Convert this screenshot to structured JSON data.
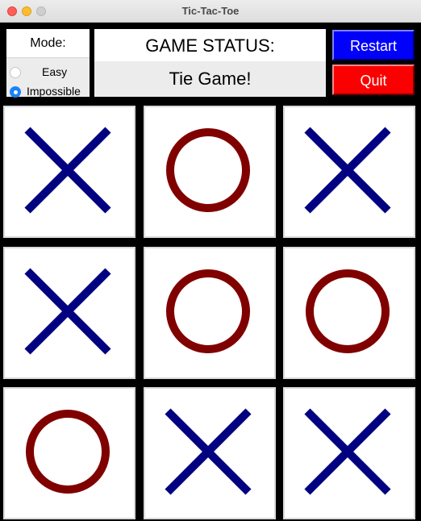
{
  "window": {
    "title": "Tic-Tac-Toe"
  },
  "mode": {
    "label": "Mode:",
    "options": [
      {
        "label": "Easy",
        "selected": false
      },
      {
        "label": "Impossible",
        "selected": true
      }
    ]
  },
  "status": {
    "heading": "GAME STATUS:",
    "value": "Tie Game!"
  },
  "buttons": {
    "restart": "Restart",
    "quit": "Quit"
  },
  "board": {
    "cells": [
      "X",
      "O",
      "X",
      "X",
      "O",
      "O",
      "O",
      "X",
      "X"
    ],
    "x_color": "#000080",
    "o_color": "#800000"
  },
  "colors": {
    "restart_bg": "#0000fb",
    "quit_bg": "#fb0000",
    "background": "#000000"
  }
}
